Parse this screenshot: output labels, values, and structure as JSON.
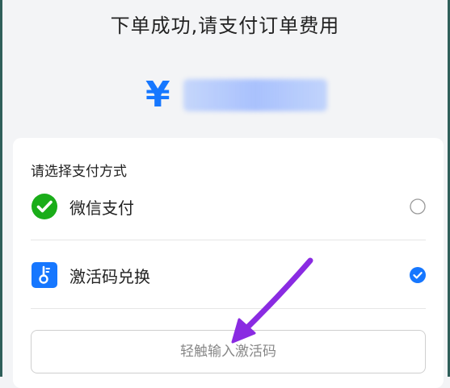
{
  "header": {
    "title": "下单成功,请支付订单费用"
  },
  "amount": {
    "currency_symbol": "¥"
  },
  "payment": {
    "heading": "请选择支付方式",
    "options": [
      {
        "label": "微信支付",
        "icon": "wechat-pay-icon",
        "selected": false
      },
      {
        "label": "激活码兑换",
        "icon": "thermometer-key-icon",
        "selected": true
      }
    ],
    "code_input_placeholder": "轻触输入激活码"
  },
  "colors": {
    "accent": "#1677ff",
    "wechat_green": "#1aad19",
    "arrow": "#8a2be2"
  }
}
